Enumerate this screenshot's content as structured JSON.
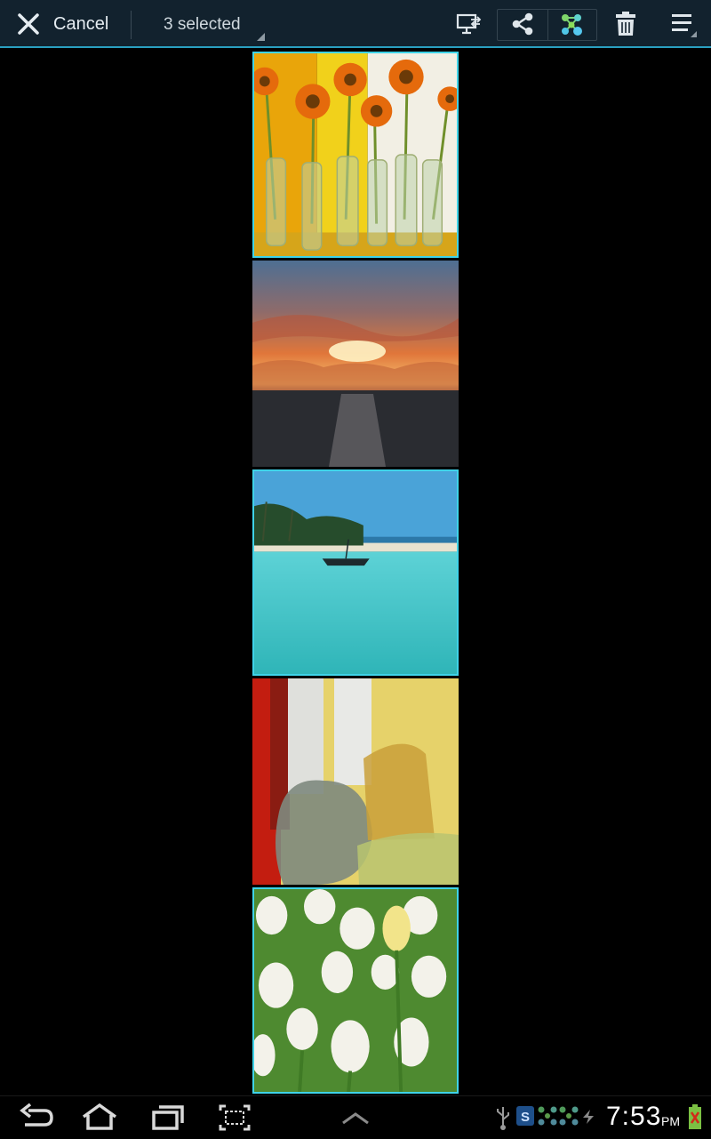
{
  "action_bar": {
    "cancel_label": "Cancel",
    "selection_label": "3 selected",
    "accent_color": "#2a9fc0",
    "icons": [
      "close-icon",
      "screen-mirror-icon",
      "share-icon",
      "share-via-group-icon",
      "delete-icon",
      "overflow-menu-icon"
    ]
  },
  "photos": [
    {
      "subject": "sunflowers-in-vases",
      "selected": true
    },
    {
      "subject": "ocean-sunset",
      "selected": false
    },
    {
      "subject": "tropical-beach-boat",
      "selected": true
    },
    {
      "subject": "glass-vases",
      "selected": false
    },
    {
      "subject": "white-tulips",
      "selected": true
    }
  ],
  "selection_color": "#3fd3e8",
  "system_bar": {
    "time": "7:53",
    "ampm": "PM",
    "icons": [
      "back-icon",
      "home-icon",
      "recent-apps-icon",
      "screenshot-icon",
      "expand-up-icon",
      "usb-icon",
      "s-app-icon",
      "share-notify-icon",
      "share-notify-icon",
      "sync-icon",
      "battery-icon"
    ]
  }
}
